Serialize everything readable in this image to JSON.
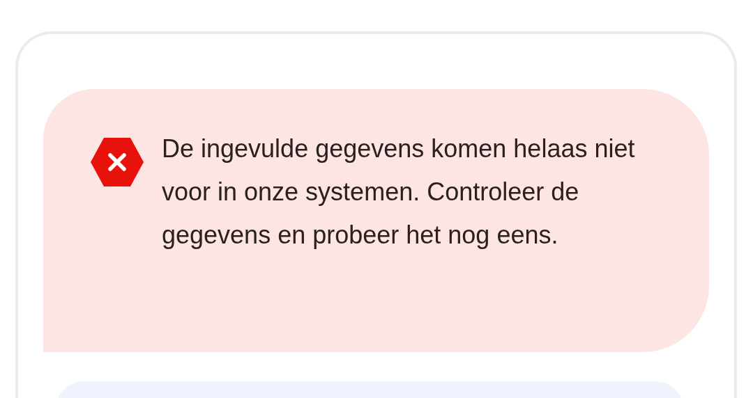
{
  "alert": {
    "kind": "error",
    "message": "De ingevulde gegevens komen helaas niet voor in onze systemen. Controleer de gegevens en probeer het nog eens."
  }
}
